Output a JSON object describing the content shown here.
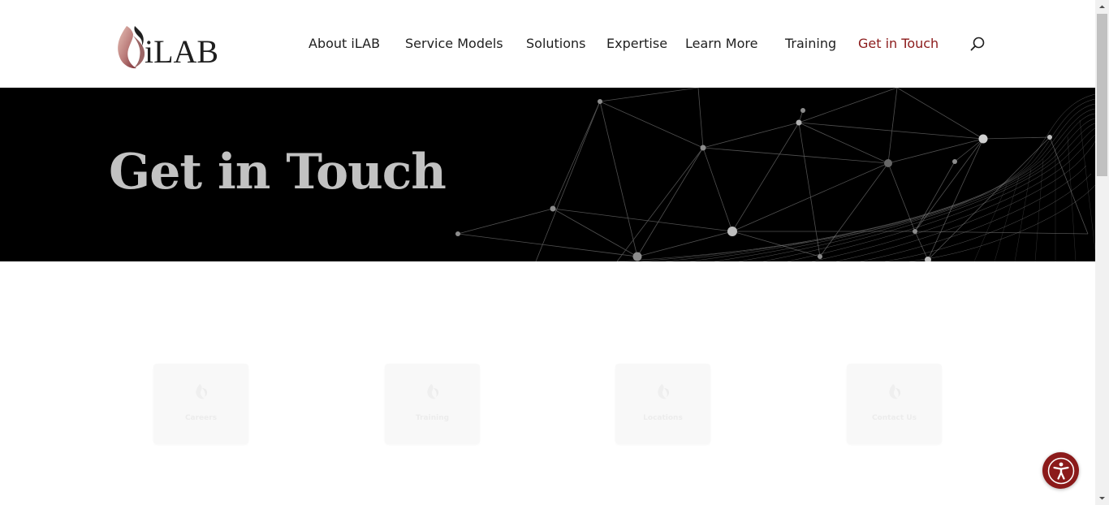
{
  "brand": {
    "name": "iLAB"
  },
  "nav": {
    "items": [
      {
        "label": "About iLAB"
      },
      {
        "label": "Service Models"
      },
      {
        "label": "Solutions"
      },
      {
        "label": "Expertise"
      },
      {
        "label": "Learn More"
      },
      {
        "label": "Training"
      },
      {
        "label": "Get in Touch",
        "active": true
      }
    ],
    "search_icon": "search-icon"
  },
  "hero": {
    "title": "Get in Touch"
  },
  "cards": [
    {
      "label": "Careers",
      "icon": "flame-icon"
    },
    {
      "label": "Training",
      "icon": "flame-icon"
    },
    {
      "label": "Locations",
      "icon": "flame-icon"
    },
    {
      "label": "Contact Us",
      "icon": "flame-icon"
    }
  ],
  "accessibility": {
    "icon": "accessibility-icon"
  },
  "colors": {
    "accent": "#8b1a1a",
    "hero_bg": "#000000",
    "hero_title": "#c2c2c2",
    "text": "#1f1f1f"
  }
}
